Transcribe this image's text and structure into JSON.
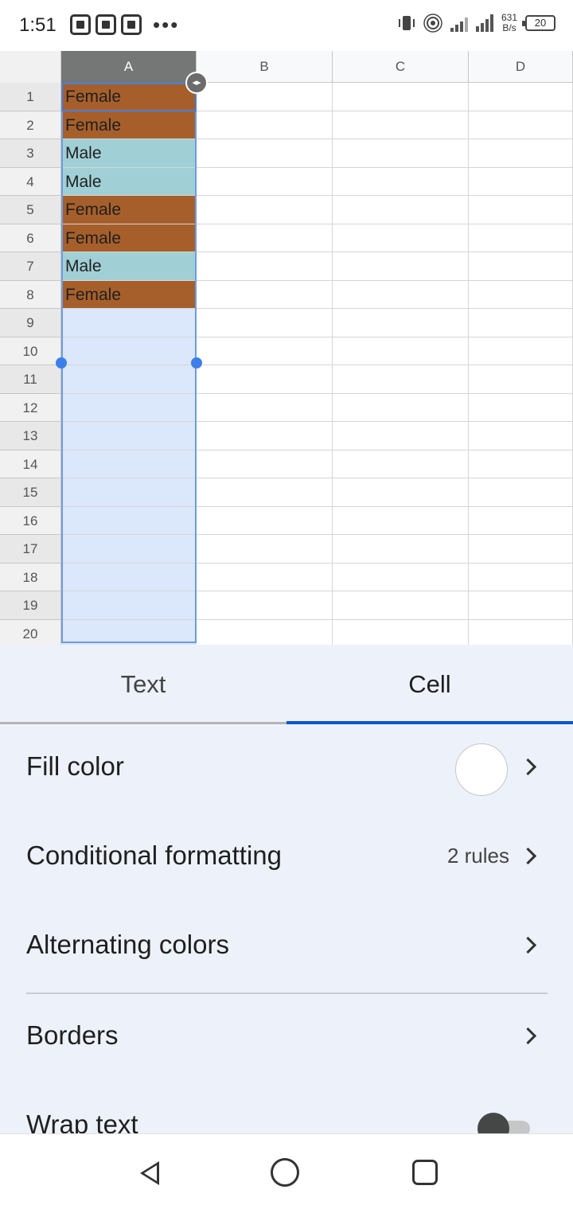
{
  "status_bar": {
    "time": "1:51",
    "more_dots": "•••",
    "net_speed_value": "631",
    "net_speed_unit": "B/s",
    "battery": "20"
  },
  "sheet": {
    "columns": [
      "A",
      "B",
      "C",
      "D"
    ],
    "rows": [
      "1",
      "2",
      "3",
      "4",
      "5",
      "6",
      "7",
      "8",
      "9",
      "10",
      "11",
      "12",
      "13",
      "14",
      "15",
      "16",
      "17",
      "18",
      "19",
      "20"
    ],
    "column_a_values": [
      "Female",
      "Female",
      "Male",
      "Male",
      "Female",
      "Female",
      "Male",
      "Female"
    ],
    "female_color": "#a65f2b",
    "male_color": "#a0d0d6",
    "selection_color": "#dbe7fb"
  },
  "panel": {
    "tabs": [
      {
        "label": "Text"
      },
      {
        "label": "Cell",
        "active": true
      }
    ],
    "options": {
      "fill_color": {
        "label": "Fill color",
        "swatch": "#ffffff"
      },
      "conditional_formatting": {
        "label": "Conditional formatting",
        "value": "2 rules"
      },
      "alternating_colors": {
        "label": "Alternating colors"
      },
      "borders": {
        "label": "Borders"
      },
      "wrap_text": {
        "label": "Wrap text",
        "enabled": false
      }
    },
    "accent_color": "#0b57d0"
  },
  "nav_bar": {
    "icons": [
      "back-icon",
      "home-icon",
      "recents-icon"
    ]
  }
}
